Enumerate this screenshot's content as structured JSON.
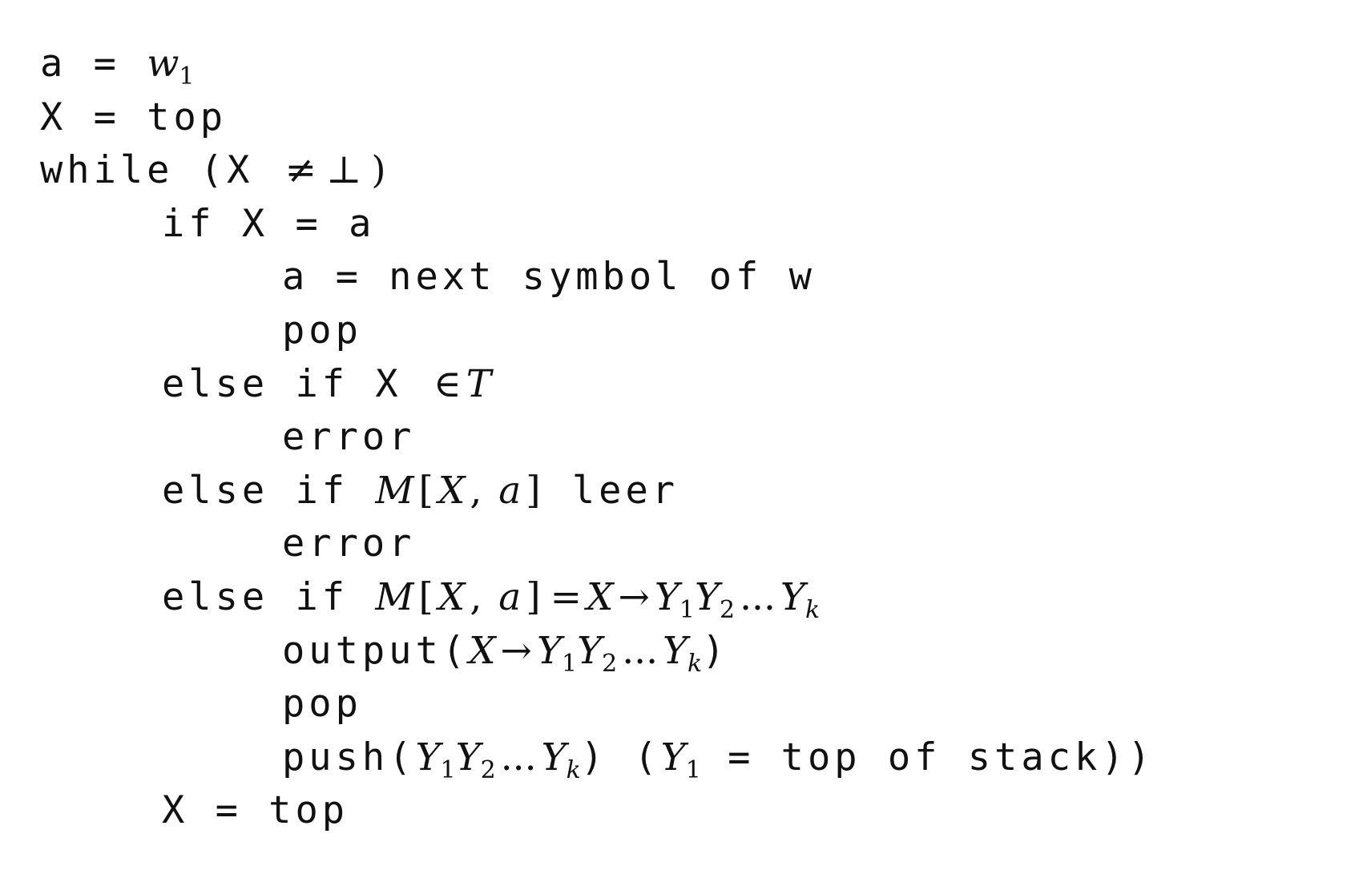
{
  "algorithm": {
    "l1": {
      "a": "a",
      "eq": " = ",
      "w": "w",
      "one": "1"
    },
    "l2": {
      "x": "X = top"
    },
    "l3": {
      "kw": "while (X ",
      "neq": "≠",
      "bot": "⊥",
      "close": ")"
    },
    "l4": {
      "text": "if X = a"
    },
    "l5": {
      "text": "a = next symbol of w"
    },
    "l6": {
      "text": "pop"
    },
    "l7": {
      "kw": "else if X ",
      "in": "∈",
      "T": "T"
    },
    "l8": {
      "text": "error"
    },
    "l9": {
      "kw": "else if ",
      "M": "M",
      "lb": "[",
      "X": "X",
      "comma": ", ",
      "a": "a",
      "rb": "]",
      "tail": " leer"
    },
    "l10": {
      "text": "error"
    },
    "l11": {
      "kw": "else if ",
      "M": "M",
      "lb": "[",
      "X": "X",
      "comma": ", ",
      "a": "a",
      "rb": "]",
      "eq": "=",
      "X2": "X",
      "arrow": "→",
      "Y": "Y",
      "s1": "1",
      "s2": "2",
      "dots": "...",
      "sk": "k"
    },
    "l12": {
      "kw": "output(",
      "X": "X",
      "arrow": "→",
      "Y": "Y",
      "s1": "1",
      "s2": "2",
      "dots": "...",
      "sk": "k",
      "close": ")"
    },
    "l13": {
      "text": "pop"
    },
    "l14": {
      "kw": "push(",
      "Y": "Y",
      "s1": "1",
      "s2": "2",
      "dots": "...",
      "sk": "k",
      "close": ") (",
      "Y1": "Y",
      "s1b": "1",
      "tail": " = top of stack))"
    },
    "l15": {
      "text": "X = top"
    }
  }
}
